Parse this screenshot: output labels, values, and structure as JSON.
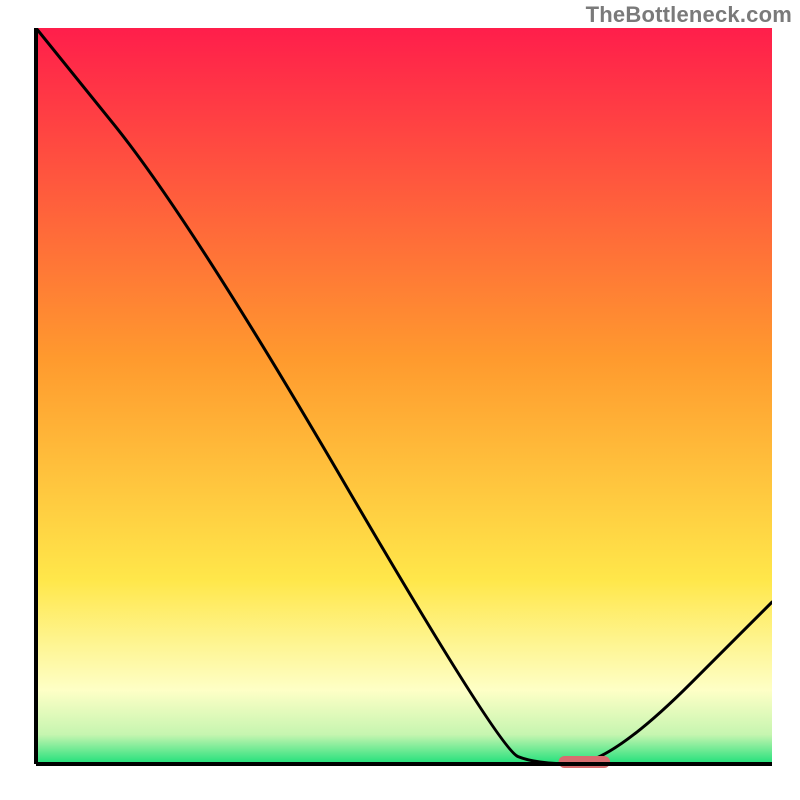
{
  "watermark": "TheBottleneck.com",
  "chart_data": {
    "type": "line",
    "title": "",
    "xlabel": "",
    "ylabel": "",
    "xlim": [
      0,
      100
    ],
    "ylim": [
      0,
      100
    ],
    "grid": false,
    "legend": false,
    "series": [
      {
        "name": "bottleneck-curve",
        "x": [
          0,
          21,
          63,
          68,
          78,
          100
        ],
        "y": [
          100,
          74,
          2,
          0,
          0,
          22
        ]
      }
    ],
    "marker": {
      "name": "optimal-segment",
      "x": 71,
      "y": 0,
      "width": 7,
      "color": "#d86d6f"
    },
    "background_gradient": {
      "top": "#ff1e4b",
      "mid1": "#ff9a2e",
      "mid2": "#ffe74a",
      "band": "#feffc6",
      "green": "#1fe07a"
    },
    "axis_color": "#000000"
  }
}
